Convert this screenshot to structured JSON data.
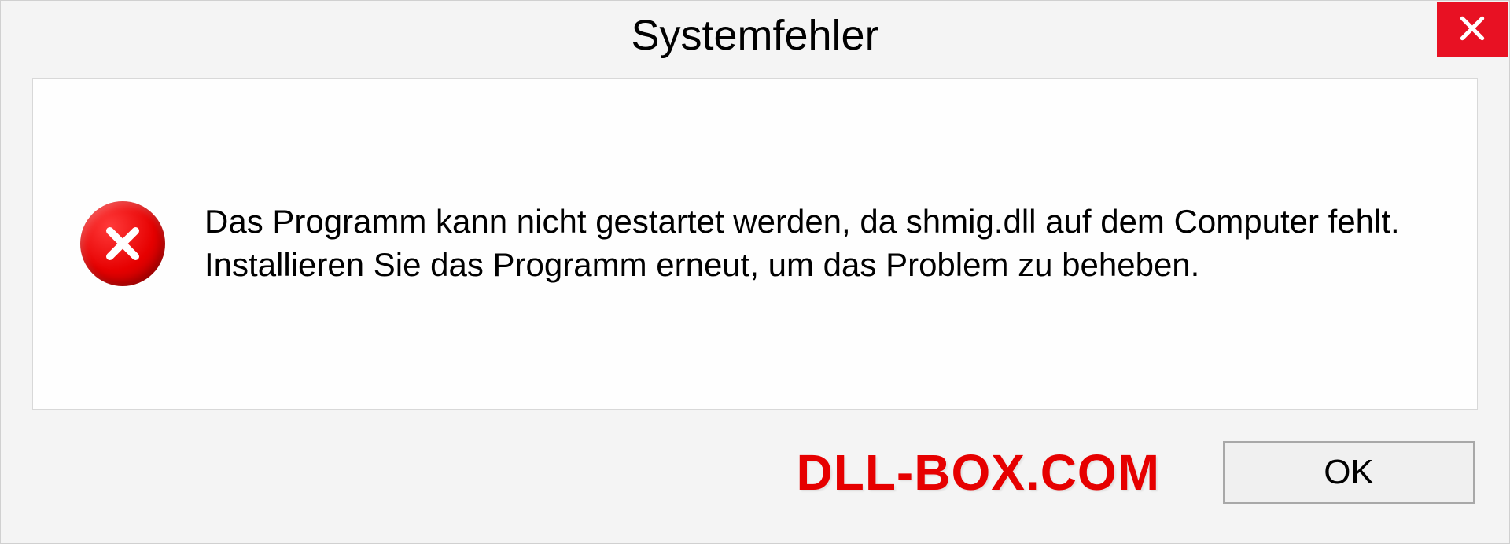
{
  "dialog": {
    "title": "Systemfehler",
    "message": "Das Programm kann nicht gestartet werden, da shmig.dll auf dem Computer fehlt. Installieren Sie das Programm erneut, um das Problem zu beheben.",
    "ok_label": "OK"
  },
  "watermark": "DLL-BOX.COM"
}
